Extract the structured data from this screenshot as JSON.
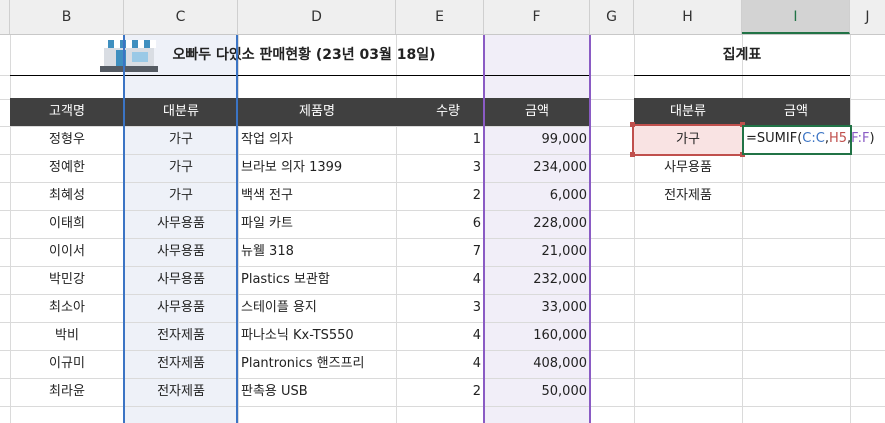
{
  "columns": [
    "B",
    "C",
    "D",
    "E",
    "F",
    "G",
    "H",
    "I",
    "J"
  ],
  "selected_column": "I",
  "title": "오빠두 다있소 판매현황 (23년 03월 18일)",
  "table": {
    "headers": {
      "customer": "고객명",
      "category": "대분류",
      "product": "제품명",
      "qty": "수량",
      "amount": "금액"
    },
    "rows": [
      {
        "customer": "정형우",
        "category": "가구",
        "product": "작업 의자",
        "qty": "1",
        "amount": "99,000"
      },
      {
        "customer": "정예한",
        "category": "가구",
        "product": "브라보 의자 1399",
        "qty": "3",
        "amount": "234,000"
      },
      {
        "customer": "최혜성",
        "category": "가구",
        "product": "백색 전구",
        "qty": "2",
        "amount": "6,000"
      },
      {
        "customer": "이태희",
        "category": "사무용품",
        "product": "파일 카트",
        "qty": "6",
        "amount": "228,000"
      },
      {
        "customer": "이이서",
        "category": "사무용품",
        "product": "뉴웰 318",
        "qty": "7",
        "amount": "21,000"
      },
      {
        "customer": "박민강",
        "category": "사무용품",
        "product": "Plastics 보관함",
        "qty": "4",
        "amount": "232,000"
      },
      {
        "customer": "최소아",
        "category": "사무용품",
        "product": "스테이플 용지",
        "qty": "3",
        "amount": "33,000"
      },
      {
        "customer": "박비",
        "category": "전자제품",
        "product": "파나소닉 Kx-TS550",
        "qty": "4",
        "amount": "160,000"
      },
      {
        "customer": "이규미",
        "category": "전자제품",
        "product": "Plantronics 핸즈프리",
        "qty": "4",
        "amount": "408,000"
      },
      {
        "customer": "최라윤",
        "category": "전자제품",
        "product": "판촉용 USB",
        "qty": "2",
        "amount": "50,000"
      }
    ]
  },
  "summary": {
    "title": "집계표",
    "headers": {
      "category": "대분류",
      "amount": "금액"
    },
    "rows": [
      "가구",
      "사무용품",
      "전자제품"
    ],
    "formula_parts": {
      "prefix": "=SUMIF(",
      "ref_c": "C:C",
      "sep1": ",",
      "ref_h": "H5",
      "sep2": ",",
      "ref_f": "F:F",
      "suffix": ")"
    }
  },
  "colors": {
    "header_bg": "#404040",
    "ref_c": "#3b74c4",
    "ref_h": "#c0504d",
    "ref_f": "#8a5bc4",
    "selected_col": "#217346"
  }
}
